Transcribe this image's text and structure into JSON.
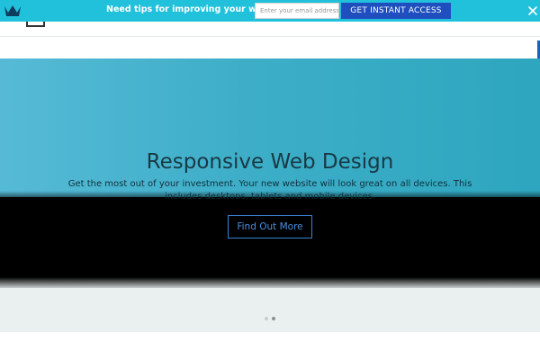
{
  "promo_bar": {
    "text": "Need tips for improving your website?",
    "email_placeholder": "Enter your email address",
    "cta_label": "GET INSTANT ACCESS",
    "bg_color": "#21c1dc",
    "button_color": "#1f4fbf",
    "logo_icon": "crown-icon",
    "close_icon": "close-icon"
  },
  "hero": {
    "title": "Responsive Web Design",
    "subtitle_line1": "Get the most out of your investment. Your new website will look great on all devices. This",
    "subtitle_line2": "includes desktops, tablets and mobile devices.",
    "button_label": "Find Out More",
    "accent_color": "#3c82d6"
  },
  "slider": {
    "dot_count": 2,
    "active_dot": 2
  }
}
